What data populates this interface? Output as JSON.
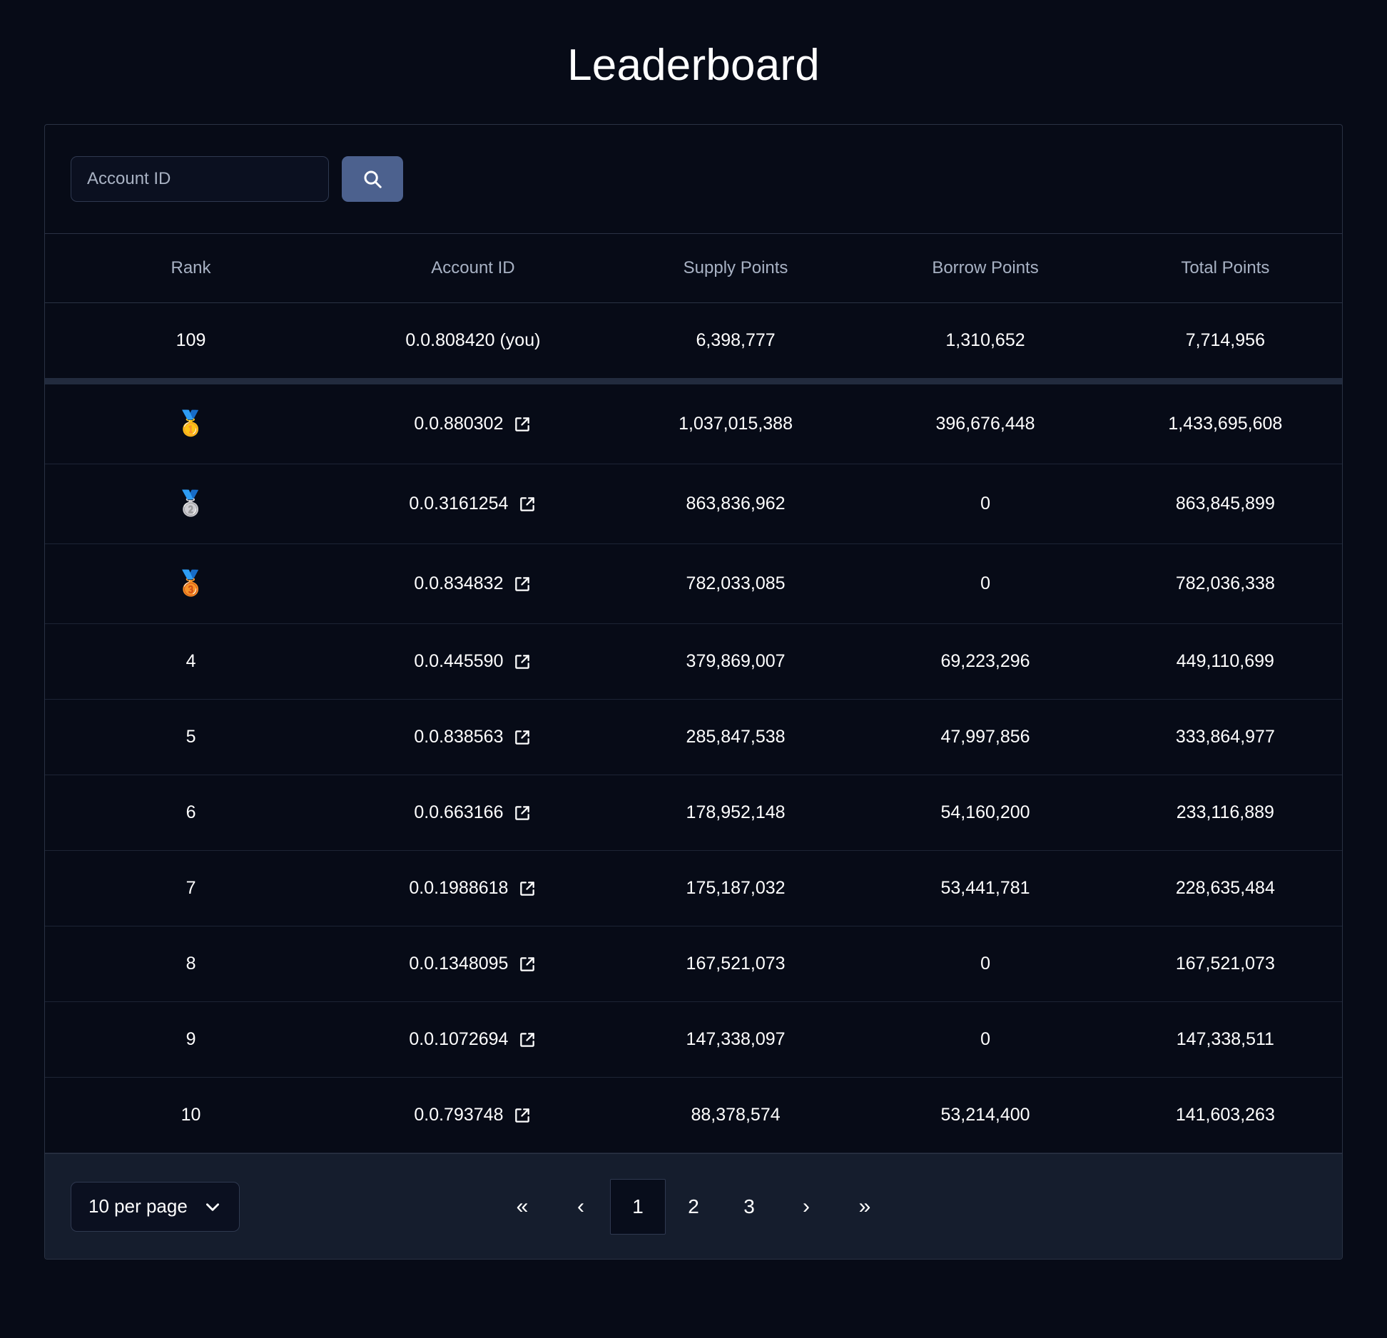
{
  "header": {
    "title": "Leaderboard"
  },
  "search": {
    "placeholder": "Account ID",
    "value": "",
    "button_icon": "search-icon"
  },
  "table": {
    "columns": [
      "Rank",
      "Account ID",
      "Supply Points",
      "Borrow Points",
      "Total Points"
    ],
    "you_row": {
      "rank": "109",
      "account_id": "0.0.808420 (you)",
      "supply_points": "6,398,777",
      "borrow_points": "1,310,652",
      "total_points": "7,714,956",
      "has_link": false
    },
    "rows": [
      {
        "rank": "1",
        "rank_medal": "🥇",
        "account_id": "0.0.880302",
        "supply_points": "1,037,015,388",
        "borrow_points": "396,676,448",
        "total_points": "1,433,695,608",
        "has_link": true
      },
      {
        "rank": "2",
        "rank_medal": "🥈",
        "account_id": "0.0.3161254",
        "supply_points": "863,836,962",
        "borrow_points": "0",
        "total_points": "863,845,899",
        "has_link": true
      },
      {
        "rank": "3",
        "rank_medal": "🥉",
        "account_id": "0.0.834832",
        "supply_points": "782,033,085",
        "borrow_points": "0",
        "total_points": "782,036,338",
        "has_link": true
      },
      {
        "rank": "4",
        "rank_medal": "",
        "account_id": "0.0.445590",
        "supply_points": "379,869,007",
        "borrow_points": "69,223,296",
        "total_points": "449,110,699",
        "has_link": true
      },
      {
        "rank": "5",
        "rank_medal": "",
        "account_id": "0.0.838563",
        "supply_points": "285,847,538",
        "borrow_points": "47,997,856",
        "total_points": "333,864,977",
        "has_link": true
      },
      {
        "rank": "6",
        "rank_medal": "",
        "account_id": "0.0.663166",
        "supply_points": "178,952,148",
        "borrow_points": "54,160,200",
        "total_points": "233,116,889",
        "has_link": true
      },
      {
        "rank": "7",
        "rank_medal": "",
        "account_id": "0.0.1988618",
        "supply_points": "175,187,032",
        "borrow_points": "53,441,781",
        "total_points": "228,635,484",
        "has_link": true
      },
      {
        "rank": "8",
        "rank_medal": "",
        "account_id": "0.0.1348095",
        "supply_points": "167,521,073",
        "borrow_points": "0",
        "total_points": "167,521,073",
        "has_link": true
      },
      {
        "rank": "9",
        "rank_medal": "",
        "account_id": "0.0.1072694",
        "supply_points": "147,338,097",
        "borrow_points": "0",
        "total_points": "147,338,511",
        "has_link": true
      },
      {
        "rank": "10",
        "rank_medal": "",
        "account_id": "0.0.793748",
        "supply_points": "88,378,574",
        "borrow_points": "53,214,400",
        "total_points": "141,603,263",
        "has_link": true
      }
    ]
  },
  "footer": {
    "per_page_label": "10 per page",
    "pagination": {
      "first_label": "«",
      "prev_label": "‹",
      "pages": [
        "1",
        "2",
        "3"
      ],
      "active_page": "1",
      "next_label": "›",
      "last_label": "»"
    }
  },
  "colors": {
    "background": "#070b17",
    "card_border": "#2a3244",
    "accent_button": "#4c618e",
    "footer_background": "#151d2d",
    "separator": "#222b3e",
    "header_text": "#a8b2c4",
    "body_text": "#ffffff"
  }
}
